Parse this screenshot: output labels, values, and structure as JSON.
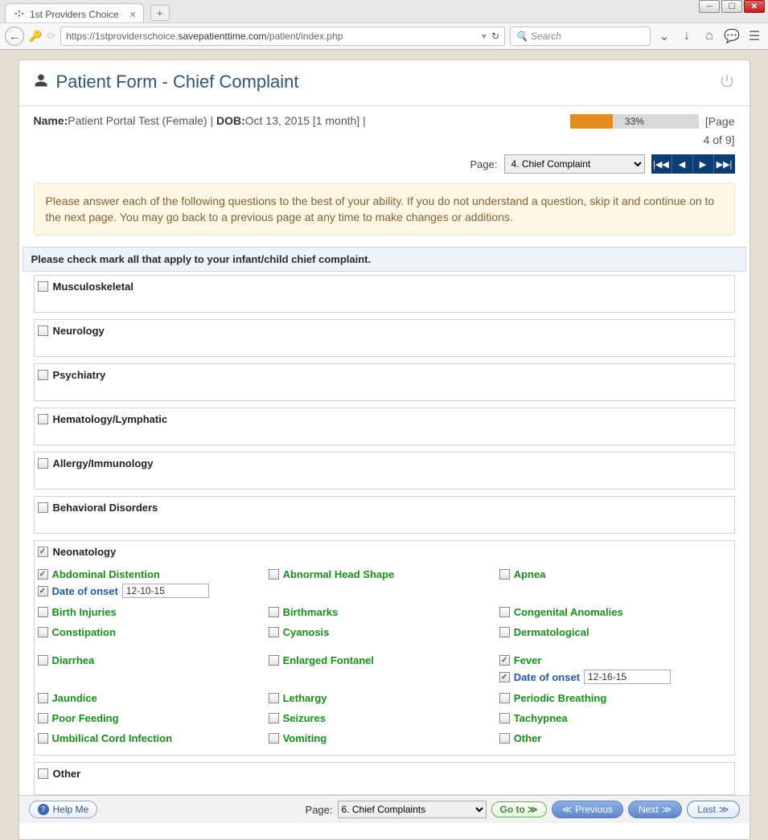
{
  "browser": {
    "tab_title": "1st Providers Choice",
    "url_prefix": "https://1stproviderschoice.",
    "url_bold": "savepatienttime.com",
    "url_suffix": "/patient/index.php",
    "search_placeholder": "Search"
  },
  "header": {
    "title": "Patient Form - Chief Complaint"
  },
  "patient": {
    "name_label": "Name:",
    "name_value": "Patient Portal Test (Female)",
    "dob_label": "DOB:",
    "dob_value": "Oct 13, 2015  [1 month]",
    "progress_pct": "33%",
    "page_indicator1": "[Page",
    "page_indicator2": "4 of 9]"
  },
  "pagenav": {
    "page_label": "Page:",
    "page_select_value": "4. Chief Complaint"
  },
  "notice": "Please answer each of the following questions to the best of your ability. If you do not understand a question, skip it and continue on to the next page. You may go back to a previous page at any time to make changes or additions.",
  "question": "Please check mark all that apply to your infant/child chief complaint.",
  "sections": {
    "musculoskeletal": "Musculoskeletal",
    "neurology": "Neurology",
    "psychiatry": "Psychiatry",
    "hematology": "Hematology/Lymphatic",
    "allergy": "Allergy/Immunology",
    "behavioral": "Behavioral Disorders",
    "neonatology": "Neonatology",
    "other": "Other"
  },
  "neonatology": {
    "abdominal_distention": "Abdominal Distention",
    "abnormal_head_shape": "Abnormal Head Shape",
    "apnea": "Apnea",
    "date_of_onset": "Date of onset",
    "date_value_1": "12-10-15",
    "birth_injuries": "Birth Injuries",
    "birthmarks": "Birthmarks",
    "congenital_anomalies": "Congenital Anomalies",
    "constipation": "Constipation",
    "cyanosis": "Cyanosis",
    "dermatological": "Dermatological",
    "diarrhea": "Diarrhea",
    "enlarged_fontanel": "Enlarged Fontanel",
    "fever": "Fever",
    "date_value_2": "12-16-15",
    "jaundice": "Jaundice",
    "lethargy": "Lethargy",
    "periodic_breathing": "Periodic Breathing",
    "poor_feeding": "Poor Feeding",
    "seizures": "Seizures",
    "tachypnea": "Tachypnea",
    "umbilical_cord_infection": "Umbilical Cord Infection",
    "vomiting": "Vomiting",
    "other": "Other"
  },
  "footer": {
    "help": "Help Me",
    "page_label": "Page:",
    "page_select_value": "6. Chief Complaints",
    "go": "Go to",
    "prev": "Previous",
    "next": "Next",
    "last": "Last"
  }
}
